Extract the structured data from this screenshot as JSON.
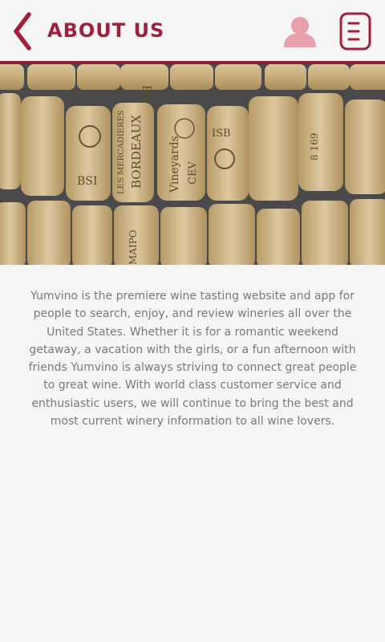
{
  "header": {
    "title": "ABOUT US",
    "back_icon": "chevron-left-icon",
    "user_icon": "user-icon",
    "menu_icon": "menu-icon"
  },
  "hero": {
    "cork_labels": [
      "EN",
      "BORDEAUX",
      "Vineyards",
      "CEV",
      "ISB",
      "BSI",
      "LES MERCADIERES",
      "MAIPO",
      "8 169"
    ]
  },
  "about": {
    "text": "Yumvino is the premiere wine tasting website and app for\npeople to search, enjoy, and review wineries all over the\nUnited States.  Whether it is for a romantic weekend\ngetaway, a vacation with the girls, or a fun afternoon with\nfriends Yumvino is always striving to connect great people\nto great wine.  With world class customer service and\nenthusiastic users, we will continue to bring the best and\nmost current winery information to all wine lovers."
  },
  "colors": {
    "brand": "#a01f3c",
    "accent_rule": "#8f1d35",
    "user_icon": "#e8a0ad",
    "background": "#f5f5f5",
    "body_text": "#7a7a7a"
  }
}
